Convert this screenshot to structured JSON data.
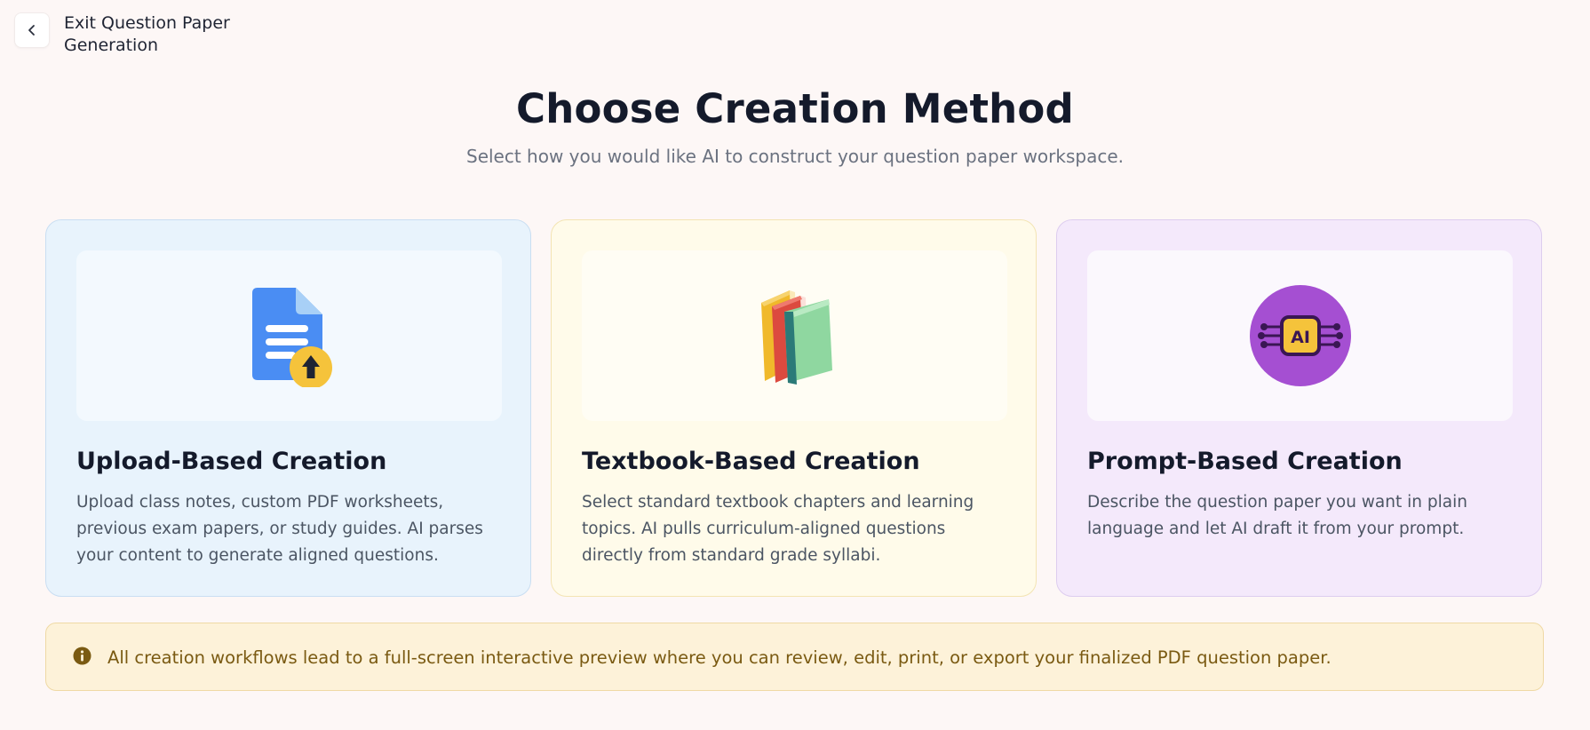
{
  "header": {
    "exit_label": "Exit Question Paper Generation",
    "title": "Choose Creation Method",
    "subtitle": "Select how you would like AI to construct your question paper workspace."
  },
  "cards": [
    {
      "id": "upload",
      "icon": "document-upload-icon",
      "title": "Upload-Based Creation",
      "description": "Upload class notes, custom PDF worksheets, previous exam papers, or study guides. AI parses your content to generate aligned questions."
    },
    {
      "id": "textbook",
      "icon": "books-icon",
      "title": "Textbook-Based Creation",
      "description": "Select standard textbook chapters and learning topics. AI pulls curriculum-aligned questions directly from standard grade syllabi."
    },
    {
      "id": "prompt",
      "icon": "ai-chip-icon",
      "icon_text": "AI",
      "title": "Prompt-Based Creation",
      "description": "Describe the question paper you want in plain language and let AI draft it from your prompt."
    }
  ],
  "notice": {
    "icon": "info-icon",
    "text": "All creation workflows lead to a full-screen interactive preview where you can review, edit, print, or export your finalized PDF question paper."
  },
  "colors": {
    "upload_card_bg": "#e8f3fc",
    "textbook_card_bg": "#fffbea",
    "prompt_card_bg": "#f4e9fb",
    "notice_bg": "#fdf2d9",
    "notice_text": "#7a5a12",
    "ai_purple": "#a54fd2"
  }
}
